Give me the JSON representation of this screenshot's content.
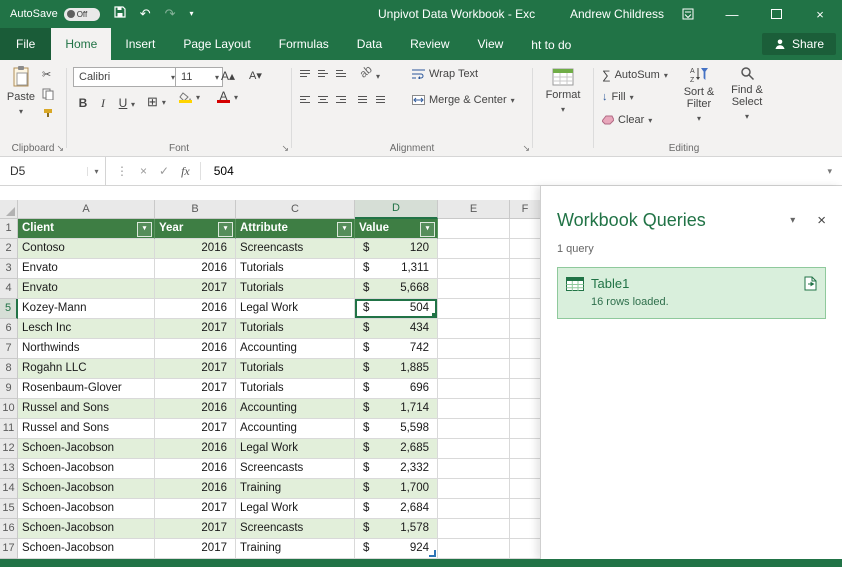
{
  "titlebar": {
    "autosave_label": "AutoSave",
    "autosave_state": "Off",
    "title": "Unpivot Data Workbook - Exc",
    "account": "Andrew Childress"
  },
  "tabs": {
    "file": "File",
    "home": "Home",
    "insert": "Insert",
    "page_layout": "Page Layout",
    "formulas": "Formulas",
    "data": "Data",
    "review": "Review",
    "view": "View",
    "tell_me": "ht to do",
    "share": "Share"
  },
  "ribbon": {
    "paste": "Paste",
    "font_name": "Calibri",
    "font_size": "11",
    "bold": "B",
    "italic": "I",
    "underline": "U",
    "wrap_text": "Wrap Text",
    "merge_center": "Merge & Center",
    "format": "Format",
    "autosum": "AutoSum",
    "fill": "Fill",
    "clear": "Clear",
    "sort_filter": "Sort & Filter",
    "find_select": "Find & Select",
    "group_clipboard": "Clipboard",
    "group_font": "Font",
    "group_alignment": "Alignment",
    "group_editing": "Editing"
  },
  "formula_bar": {
    "name_box": "D5",
    "fx": "fx",
    "value": "504"
  },
  "sheet": {
    "col_headers": [
      "A",
      "B",
      "C",
      "D",
      "E",
      "F"
    ],
    "selected_col": "D",
    "selected_row": 5,
    "table_headers": [
      "Client",
      "Year",
      "Attribute",
      "Value"
    ],
    "currency_symbol": "$",
    "rows": [
      {
        "n": 2,
        "client": "Contoso",
        "year": "2016",
        "attribute": "Screencasts",
        "value": "120"
      },
      {
        "n": 3,
        "client": "Envato",
        "year": "2016",
        "attribute": "Tutorials",
        "value": "1,311"
      },
      {
        "n": 4,
        "client": "Envato",
        "year": "2017",
        "attribute": "Tutorials",
        "value": "5,668"
      },
      {
        "n": 5,
        "client": "Kozey-Mann",
        "year": "2016",
        "attribute": "Legal Work",
        "value": "504"
      },
      {
        "n": 6,
        "client": "Lesch Inc",
        "year": "2017",
        "attribute": "Tutorials",
        "value": "434"
      },
      {
        "n": 7,
        "client": "Northwinds",
        "year": "2016",
        "attribute": "Accounting",
        "value": "742"
      },
      {
        "n": 8,
        "client": "Rogahn LLC",
        "year": "2017",
        "attribute": "Tutorials",
        "value": "1,885"
      },
      {
        "n": 9,
        "client": "Rosenbaum-Glover",
        "year": "2017",
        "attribute": "Tutorials",
        "value": "696"
      },
      {
        "n": 10,
        "client": "Russel and Sons",
        "year": "2016",
        "attribute": "Accounting",
        "value": "1,714"
      },
      {
        "n": 11,
        "client": "Russel and Sons",
        "year": "2017",
        "attribute": "Accounting",
        "value": "5,598"
      },
      {
        "n": 12,
        "client": "Schoen-Jacobson",
        "year": "2016",
        "attribute": "Legal Work",
        "value": "2,685"
      },
      {
        "n": 13,
        "client": "Schoen-Jacobson",
        "year": "2016",
        "attribute": "Screencasts",
        "value": "2,332"
      },
      {
        "n": 14,
        "client": "Schoen-Jacobson",
        "year": "2016",
        "attribute": "Training",
        "value": "1,700"
      },
      {
        "n": 15,
        "client": "Schoen-Jacobson",
        "year": "2017",
        "attribute": "Legal Work",
        "value": "2,684"
      },
      {
        "n": 16,
        "client": "Schoen-Jacobson",
        "year": "2017",
        "attribute": "Screencasts",
        "value": "1,578"
      },
      {
        "n": 17,
        "client": "Schoen-Jacobson",
        "year": "2017",
        "attribute": "Training",
        "value": "924"
      }
    ]
  },
  "panel": {
    "title": "Workbook Queries",
    "count": "1 query",
    "query_name": "Table1",
    "query_status": "16 rows loaded."
  },
  "colors": {
    "excel_green": "#217346",
    "table_header_green": "#3e7e44",
    "band_green": "#e2efda"
  }
}
